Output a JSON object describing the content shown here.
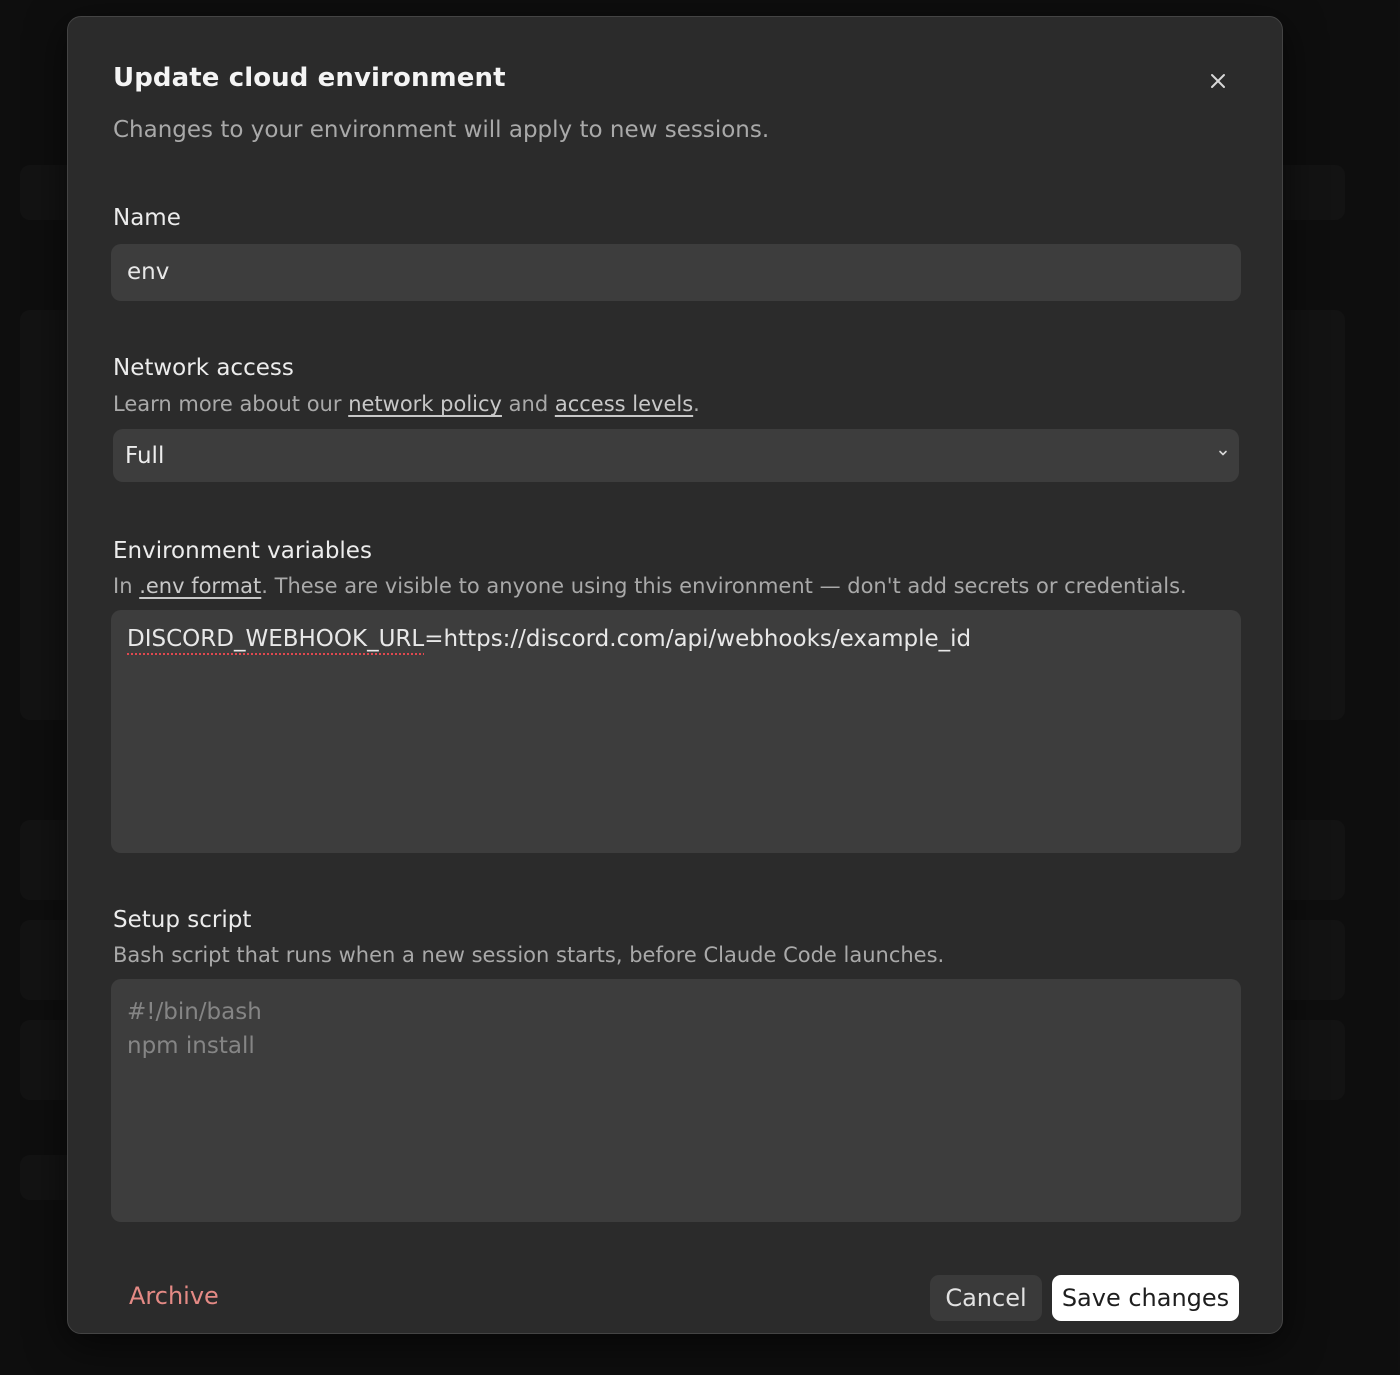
{
  "modal": {
    "title": "Update cloud environment",
    "subtitle": "Changes to your environment will apply to new sessions."
  },
  "name_field": {
    "label": "Name",
    "value": "env"
  },
  "network_access": {
    "label": "Network access",
    "help_prefix": "Learn more about our ",
    "link_network_policy": "network policy",
    "help_and": " and ",
    "link_access_levels": "access levels",
    "help_suffix": ".",
    "selected": "Full"
  },
  "env_vars": {
    "label": "Environment variables",
    "help_prefix": "In ",
    "link_env_format": ".env format",
    "help_suffix": ". These are visible to anyone using this environment — don't add secrets or credentials.",
    "value_key": "DISCORD_WEBHOOK_URL",
    "value_rest": "=https://discord.com/api/webhooks/example_id"
  },
  "setup_script": {
    "label": "Setup script",
    "help": "Bash script that runs when a new session starts, before Claude Code launches.",
    "placeholder_line1": "#!/bin/bash",
    "placeholder_line2": "npm install"
  },
  "footer": {
    "archive_label": "Archive",
    "cancel_label": "Cancel",
    "save_label": "Save changes"
  },
  "colors": {
    "modal_bg": "#2b2b2b",
    "field_bg": "#3d3d3d",
    "archive_text": "#e48a85",
    "save_bg": "#ffffff"
  },
  "icons": {
    "close": "close-icon",
    "select_chevron": "chevron-down-icon"
  }
}
